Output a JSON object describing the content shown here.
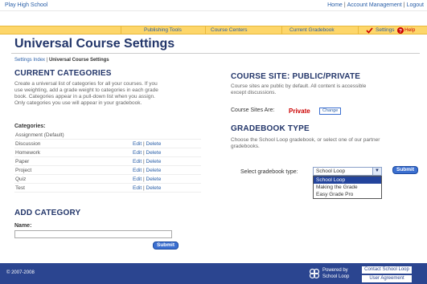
{
  "topbar": {
    "school_name": "Play High School",
    "links": [
      "Home",
      "Account Management",
      "Logout"
    ]
  },
  "nav": {
    "items": [
      "Publishing Tools",
      "Course Centers",
      "Current Gradebook"
    ],
    "settings_label": "Settings",
    "help_label": "Help"
  },
  "page_title": "Universal Course Settings",
  "breadcrumb": {
    "parent": "Settings Index",
    "separator": " | ",
    "current": "Universal Course Settings"
  },
  "current_categories": {
    "heading": "CURRENT CATEGORIES",
    "description_lines": [
      "Create a universal list of categories for all your courses. If you",
      "use weighting, add a grade weight to categories in each grade",
      "book. Categories appear in a pull-down list when you assign.",
      "Only categories you use will appear in your gradebook."
    ],
    "list_label": "Categories:",
    "edit_label": "Edit",
    "delete_label": "Delete",
    "rows": [
      {
        "name": "Assignment (Default)",
        "editable": false
      },
      {
        "name": "Discussion",
        "editable": true
      },
      {
        "name": "Homework",
        "editable": true
      },
      {
        "name": "Paper",
        "editable": true
      },
      {
        "name": "Project",
        "editable": true
      },
      {
        "name": "Quiz",
        "editable": true
      },
      {
        "name": "Test",
        "editable": true
      }
    ]
  },
  "add_category": {
    "heading": "ADD CATEGORY",
    "name_label": "Name:",
    "name_value": "",
    "submit_label": "Submit"
  },
  "course_site": {
    "heading": "COURSE SITE: PUBLIC/PRIVATE",
    "description_lines": [
      "Course sites are public by default. All content is accessible",
      "except discussions."
    ],
    "status_label": "Course Sites Are:",
    "status_value": "Private",
    "change_label": "Change"
  },
  "gradebook_type": {
    "heading": "GRADEBOOK TYPE",
    "description_lines": [
      "Choose the School Loop gradebook, or select one of our partner",
      "gradebooks."
    ],
    "select_label": "Select gradebook type:",
    "selected": "School Loop",
    "options": [
      "School Loop",
      "Making the Grade",
      "Easy Grade Pro"
    ],
    "submit_label": "Submit"
  },
  "footer": {
    "copyright": "© 2007-2008",
    "powered_lines": [
      "Powered by",
      "School Loop"
    ],
    "contact_label": "Contact School Loop",
    "agreement_label": "User Agreement"
  },
  "colors": {
    "title": "#23366a",
    "link": "#2a5fa8",
    "nav_bg": "#fdd66a",
    "footer_bg": "#2b4590",
    "private": "#cc0000",
    "button": "#3b6fd0"
  }
}
